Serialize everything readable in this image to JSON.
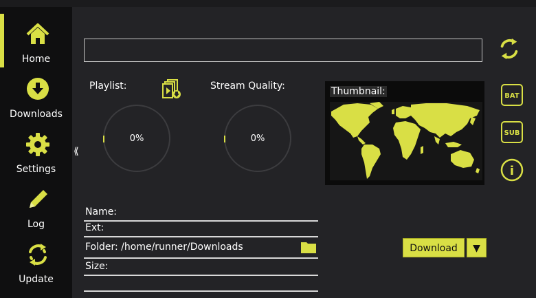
{
  "colors": {
    "accent": "#d9df45",
    "sidebar_bg": "#0f0f10",
    "main_bg": "#232326"
  },
  "sidebar": {
    "items": [
      {
        "label": "Home",
        "icon": "home-icon",
        "active": true
      },
      {
        "label": "Downloads",
        "icon": "download-icon",
        "active": false
      },
      {
        "label": "Settings",
        "icon": "gear-icon",
        "active": false
      },
      {
        "label": "Log",
        "icon": "pencil-icon",
        "active": false
      },
      {
        "label": "Update",
        "icon": "refresh-icon",
        "active": false
      }
    ]
  },
  "main": {
    "url_value": "",
    "collapse_glyph": "⟪",
    "playlist": {
      "label": "Playlist:",
      "percent": "0%"
    },
    "stream_quality": {
      "label": "Stream Quality:",
      "percent": "0%"
    },
    "thumbnail": {
      "label": "Thumbnail:"
    },
    "fields": {
      "name": "Name:",
      "ext": "Ext:",
      "folder": "Folder: /home/runner/Downloads",
      "size": "Size:"
    },
    "download_button": "Download",
    "dropdown_glyph": "▼",
    "right_icons": {
      "bat": "BAT",
      "sub": "SUB",
      "info": "i"
    }
  }
}
